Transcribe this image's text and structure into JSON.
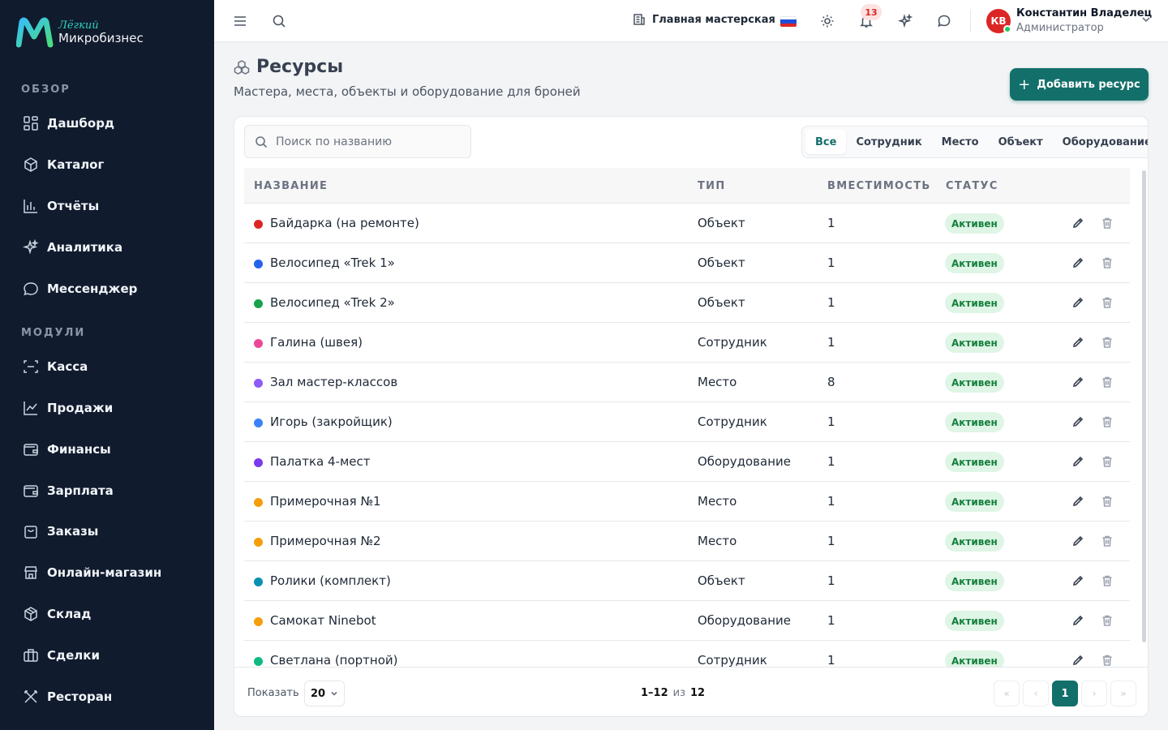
{
  "brand": {
    "small": "Лёгкий",
    "main": "Микробизнес"
  },
  "sidebar": {
    "section_overview": "ОБЗОР",
    "section_modules": "МОДУЛИ",
    "items": [
      {
        "label": "Дашборд",
        "icon": "grid-icon"
      },
      {
        "label": "Каталог",
        "icon": "box-icon"
      },
      {
        "label": "Отчёты",
        "icon": "bar-chart-icon"
      },
      {
        "label": "Аналитика",
        "icon": "sparkles-icon"
      },
      {
        "label": "Мессенджер",
        "icon": "chat-icon"
      },
      {
        "label": "Касса",
        "icon": "scan-icon"
      },
      {
        "label": "Продажи",
        "icon": "line-chart-icon"
      },
      {
        "label": "Финансы",
        "icon": "wallet-icon"
      },
      {
        "label": "Зарплата",
        "icon": "wallet-icon"
      },
      {
        "label": "Заказы",
        "icon": "shopping-bag-icon"
      },
      {
        "label": "Онлайн-магазин",
        "icon": "store-icon"
      },
      {
        "label": "Склад",
        "icon": "package-icon"
      },
      {
        "label": "Сделки",
        "icon": "briefcase-icon"
      },
      {
        "label": "Ресторан",
        "icon": "utensils-icon"
      }
    ]
  },
  "header": {
    "workshop": "Главная мастерская",
    "notifications_count": "13",
    "user": {
      "initials": "КВ",
      "name": "Константин Владелец",
      "role": "Администратор"
    }
  },
  "page": {
    "title": "Ресурсы",
    "subtitle": "Мастера, места, объекты и оборудование для броней",
    "add_button": "Добавить ресурс"
  },
  "search": {
    "placeholder": "Поиск по названию"
  },
  "filters": [
    "Все",
    "Сотрудник",
    "Место",
    "Объект",
    "Оборудование"
  ],
  "active_filter": "Все",
  "table": {
    "columns": [
      "НАЗВАНИЕ",
      "ТИП",
      "ВМЕСТИМОСТЬ",
      "СТАТУС"
    ],
    "rows": [
      {
        "name": "Байдарка (на ремонте)",
        "type": "Объект",
        "capacity": "1",
        "status": "Активен",
        "color": "#dc2626"
      },
      {
        "name": "Велосипед «Trek 1»",
        "type": "Объект",
        "capacity": "1",
        "status": "Активен",
        "color": "#2563eb"
      },
      {
        "name": "Велосипед «Trek 2»",
        "type": "Объект",
        "capacity": "1",
        "status": "Активен",
        "color": "#16a34a"
      },
      {
        "name": "Галина (швея)",
        "type": "Сотрудник",
        "capacity": "1",
        "status": "Активен",
        "color": "#ec4899"
      },
      {
        "name": "Зал мастер-классов",
        "type": "Место",
        "capacity": "8",
        "status": "Активен",
        "color": "#8b5cf6"
      },
      {
        "name": "Игорь (закройщик)",
        "type": "Сотрудник",
        "capacity": "1",
        "status": "Активен",
        "color": "#3b82f6"
      },
      {
        "name": "Палатка 4-мест",
        "type": "Оборудование",
        "capacity": "1",
        "status": "Активен",
        "color": "#7c3aed"
      },
      {
        "name": "Примерочная №1",
        "type": "Место",
        "capacity": "1",
        "status": "Активен",
        "color": "#f59e0b"
      },
      {
        "name": "Примерочная №2",
        "type": "Место",
        "capacity": "1",
        "status": "Активен",
        "color": "#f59e0b"
      },
      {
        "name": "Ролики (комплект)",
        "type": "Объект",
        "capacity": "1",
        "status": "Активен",
        "color": "#0891b2"
      },
      {
        "name": "Самокат Ninebot",
        "type": "Оборудование",
        "capacity": "1",
        "status": "Активен",
        "color": "#f59e0b"
      },
      {
        "name": "Светлана (портной)",
        "type": "Сотрудник",
        "capacity": "1",
        "status": "Активен",
        "color": "#10b981"
      }
    ]
  },
  "pagination": {
    "show_label": "Показать",
    "page_size": "20",
    "range": "1–12",
    "of": "из",
    "total": "12",
    "current_page": "1"
  }
}
